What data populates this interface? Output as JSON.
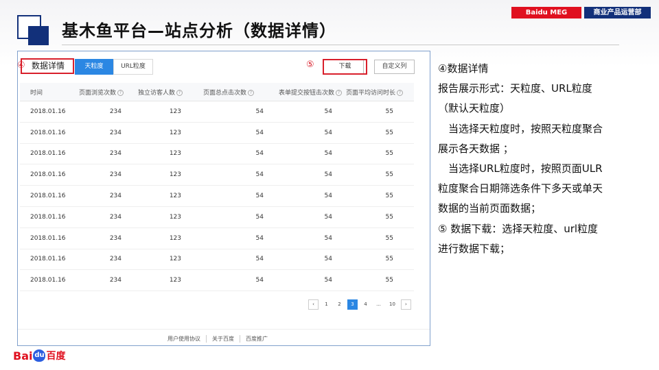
{
  "badges": {
    "left": "Baidu MEG",
    "right": "商业产品运营部"
  },
  "title": "基木鱼平台—站点分析（数据详情）",
  "panel": {
    "mark4": "④",
    "mark5": "⑤",
    "title": "数据详情",
    "seg_day": "天粒度",
    "seg_url": "URL粒度",
    "download": "下载",
    "custom": "自定义列",
    "help_glyph": "?",
    "headers": [
      "时间",
      "页面浏览次数",
      "独立访客人数",
      "页面总点击次数",
      "表单提交按钮击次数",
      "页面平均访问时长"
    ],
    "rows": [
      [
        "2018.01.16",
        "234",
        "123",
        "54",
        "54",
        "55"
      ],
      [
        "2018.01.16",
        "234",
        "123",
        "54",
        "54",
        "55"
      ],
      [
        "2018.01.16",
        "234",
        "123",
        "54",
        "54",
        "55"
      ],
      [
        "2018.01.16",
        "234",
        "123",
        "54",
        "54",
        "55"
      ],
      [
        "2018.01.16",
        "234",
        "123",
        "54",
        "54",
        "55"
      ],
      [
        "2018.01.16",
        "234",
        "123",
        "54",
        "54",
        "55"
      ],
      [
        "2018.01.16",
        "234",
        "123",
        "54",
        "54",
        "55"
      ],
      [
        "2018.01.16",
        "234",
        "123",
        "54",
        "54",
        "55"
      ],
      [
        "2018.01.16",
        "234",
        "123",
        "54",
        "54",
        "55"
      ]
    ],
    "pager": [
      "‹",
      "1",
      "2",
      "3",
      "4",
      "...",
      "10",
      "›"
    ],
    "pager_active": "3",
    "footer": [
      "用户使用协议",
      "关于百度",
      "百度推广"
    ]
  },
  "description": [
    "④数据详情",
    "报告展示形式：天粒度、URL粒度",
    "（默认天粒度）",
    "　当选择天粒度时，按照天粒度聚合",
    "展示各天数据 ；",
    "　当选择URL粒度时，按照页面ULR",
    "粒度聚合日期筛选条件下多天或单天",
    "数据的当前页面数据；",
    "⑤ 数据下载：选择天粒度、url粒度",
    "进行数据下载；"
  ],
  "logo": {
    "bai": "Bai",
    "paw": "du",
    "du": "百度"
  },
  "colors": {
    "brand_red": "#e0101f",
    "brand_navy": "#12307a",
    "accent_blue": "#2b87e3"
  }
}
